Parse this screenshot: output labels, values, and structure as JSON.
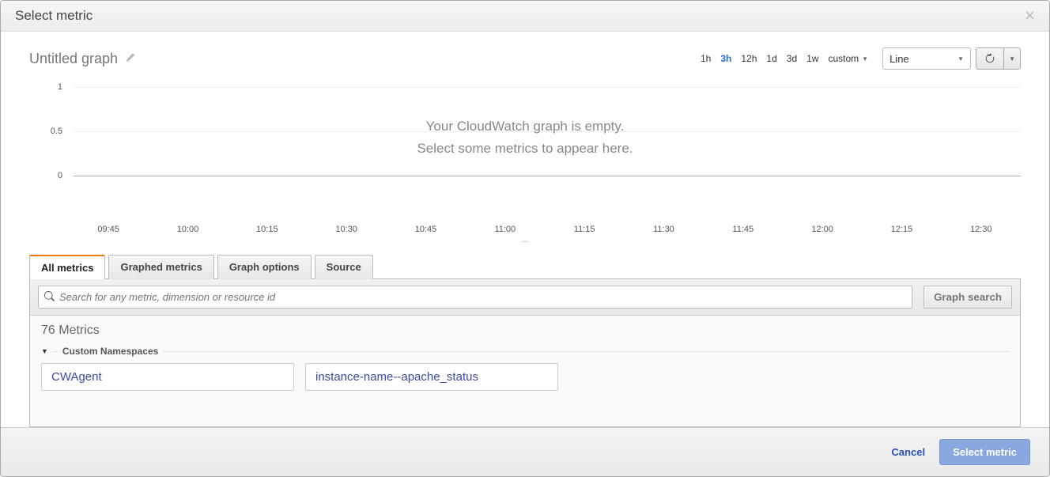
{
  "modal": {
    "title": "Select metric",
    "close_label": "×"
  },
  "graph": {
    "title": "Untitled graph",
    "empty_main": "Your CloudWatch graph is empty.",
    "empty_sub": "Select some metrics to appear here.",
    "y_ticks": [
      "1",
      "0.5",
      "0"
    ],
    "x_ticks": [
      "09:45",
      "10:00",
      "10:15",
      "10:30",
      "10:45",
      "11:00",
      "11:15",
      "11:30",
      "11:45",
      "12:00",
      "12:15",
      "12:30"
    ],
    "sub_indicator": "..."
  },
  "time_options": {
    "items": [
      "1h",
      "3h",
      "12h",
      "1d",
      "3d",
      "1w",
      "custom"
    ],
    "active_index": 1
  },
  "chart_type": {
    "selected": "Line"
  },
  "tabs": {
    "items": [
      "All metrics",
      "Graphed metrics",
      "Graph options",
      "Source"
    ],
    "active_index": 0
  },
  "search": {
    "placeholder": "Search for any metric, dimension or resource id",
    "graph_search_label": "Graph search"
  },
  "metrics": {
    "count_label": "76 Metrics",
    "section_label": "Custom Namespaces",
    "namespaces": [
      "CWAgent",
      "instance-name--apache_status"
    ]
  },
  "footer": {
    "cancel": "Cancel",
    "select": "Select metric"
  },
  "chart_data": {
    "type": "line",
    "title": "Untitled graph",
    "xlabel": "",
    "ylabel": "",
    "ylim": [
      0,
      1
    ],
    "x": [
      "09:45",
      "10:00",
      "10:15",
      "10:30",
      "10:45",
      "11:00",
      "11:15",
      "11:30",
      "11:45",
      "12:00",
      "12:15",
      "12:30"
    ],
    "series": []
  }
}
